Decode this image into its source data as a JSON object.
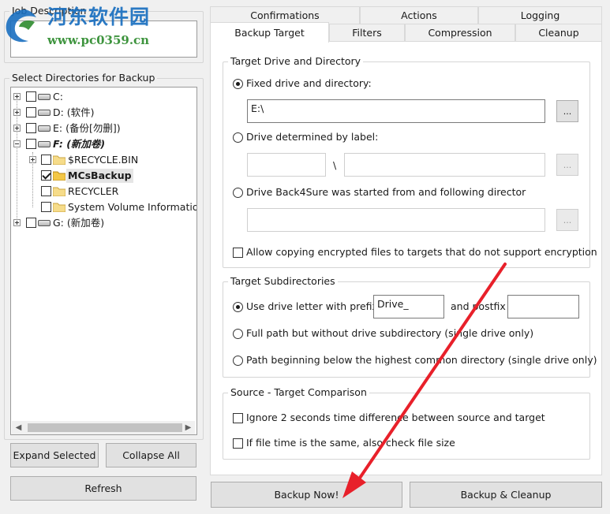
{
  "watermark": {
    "logo_text": "河东软件园",
    "url_text": "www.pc0359.cn"
  },
  "left": {
    "job_description_label": "Job Description",
    "job_description_value": "",
    "select_dirs_label": "Select Directories for Backup",
    "tree": [
      {
        "label": "C:",
        "kind": "drive",
        "checked": false,
        "expander": "plus"
      },
      {
        "label": "D: (软件)",
        "kind": "drive",
        "checked": false,
        "expander": "plus"
      },
      {
        "label": "E: (备份[勿删])",
        "kind": "drive",
        "checked": false,
        "expander": "plus"
      },
      {
        "label": "F: (新加卷)",
        "kind": "drive",
        "checked": false,
        "expander": "minus"
      },
      {
        "label": "$RECYCLE.BIN",
        "kind": "folder",
        "checked": false,
        "expander": "plus"
      },
      {
        "label": "MCsBackup",
        "kind": "folder",
        "checked": true,
        "expander": "none"
      },
      {
        "label": "RECYCLER",
        "kind": "folder",
        "checked": false,
        "expander": "none"
      },
      {
        "label": "System Volume Information",
        "kind": "folder",
        "checked": false,
        "expander": "none"
      },
      {
        "label": "G: (新加卷)",
        "kind": "drive",
        "checked": false,
        "expander": "plus"
      }
    ],
    "expand_selected_label": "Expand Selected",
    "collapse_all_label": "Collapse All",
    "refresh_label": "Refresh"
  },
  "tabs": {
    "row1": [
      "Confirmations",
      "Actions",
      "Logging"
    ],
    "row2": [
      "Backup Target",
      "Filters",
      "Compression",
      "Cleanup"
    ],
    "active": "Backup Target"
  },
  "target_drive": {
    "title": "Target Drive and Directory",
    "fixed_label": "Fixed drive and directory:",
    "fixed_value": "E:\\",
    "browse_label": "...",
    "by_label_label": "Drive determined by label:",
    "label_value": "",
    "separator": "\\",
    "path_value": "",
    "started_from_label": "Drive Back4Sure was started from and following director",
    "started_value": "",
    "allow_encrypted_label": "Allow copying encrypted files to targets that do not support encryption",
    "selected": "fixed"
  },
  "target_subdirs": {
    "title": "Target Subdirectories",
    "use_letter_label": "Use drive letter with prefix",
    "prefix_value": "Drive_",
    "and_postfix_label": "and postfix",
    "postfix_value": "",
    "full_path_label": "Full path but without drive subdirectory (single drive only)",
    "path_beginning_label": "Path beginning below the highest common directory (single drive only)",
    "selected": "use_letter"
  },
  "comparison": {
    "title": "Source - Target Comparison",
    "ignore_2s_label": "Ignore 2 seconds time difference between source and target",
    "check_size_label": "If file time is the same, also check file size"
  },
  "bottom": {
    "backup_now_label": "Backup Now!",
    "backup_cleanup_label": "Backup & Cleanup"
  },
  "colors": {
    "annotation_arrow": "#e8202a",
    "watermark_blue": "#1a6fc0",
    "watermark_green": "#2e8b2e"
  }
}
